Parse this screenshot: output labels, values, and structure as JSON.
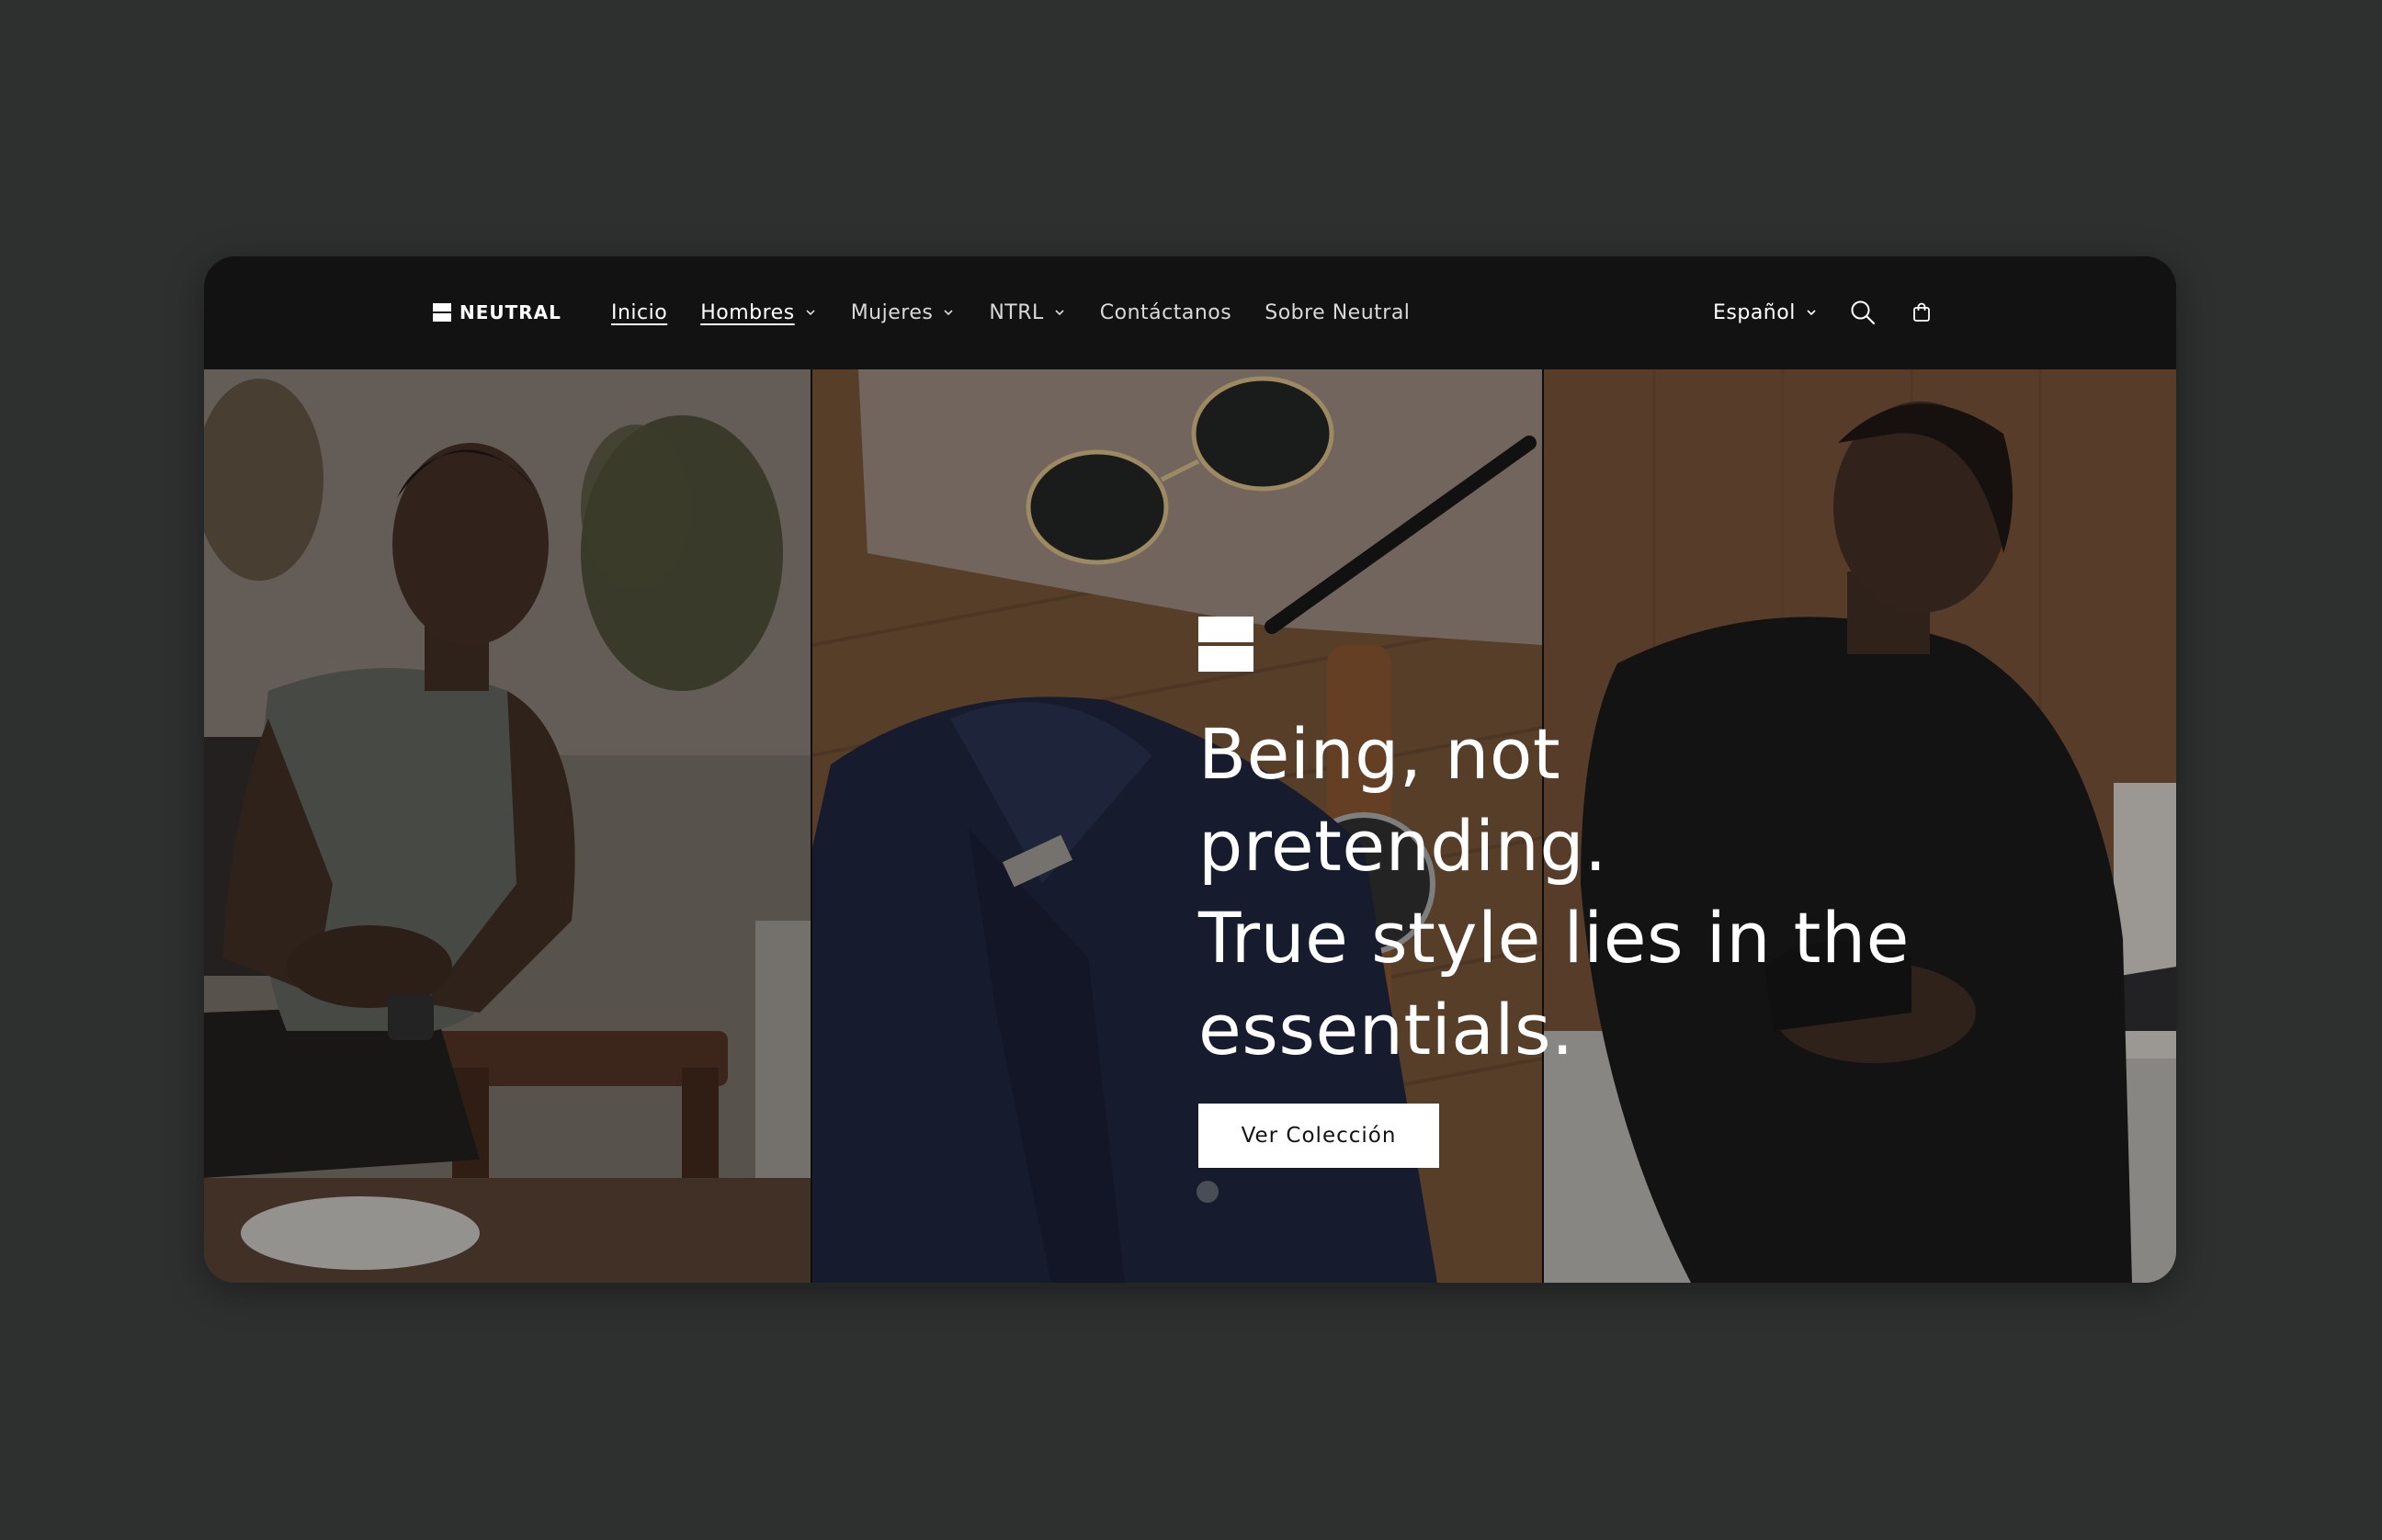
{
  "brand": {
    "name": "NEUTRAL"
  },
  "nav": {
    "items": [
      {
        "label": "Inicio",
        "has_dropdown": false,
        "active": true
      },
      {
        "label": "Hombres",
        "has_dropdown": true,
        "active": true
      },
      {
        "label": "Mujeres",
        "has_dropdown": true,
        "active": false
      },
      {
        "label": "NTRL",
        "has_dropdown": true,
        "active": false
      },
      {
        "label": "Contáctanos",
        "has_dropdown": false,
        "active": false
      },
      {
        "label": "Sobre Neutral",
        "has_dropdown": false,
        "active": false
      }
    ]
  },
  "header_right": {
    "language": "Español",
    "icons": [
      "search-icon",
      "cart-icon"
    ]
  },
  "hero": {
    "heading_lines": [
      "Being, not",
      "pretending.",
      "True style lies in the",
      "essentials."
    ],
    "cta_label": "Ver Colección",
    "images": [
      "man-grey-tshirt-photo",
      "flatlay-shirt-sunglasses-watch-photo",
      "man-black-sweater-photo"
    ]
  },
  "colors": {
    "page_background": "#2e2f2f",
    "header_background": "#121212",
    "text_light": "#ffffff",
    "button_background": "#ffffff",
    "button_text": "#121212"
  }
}
